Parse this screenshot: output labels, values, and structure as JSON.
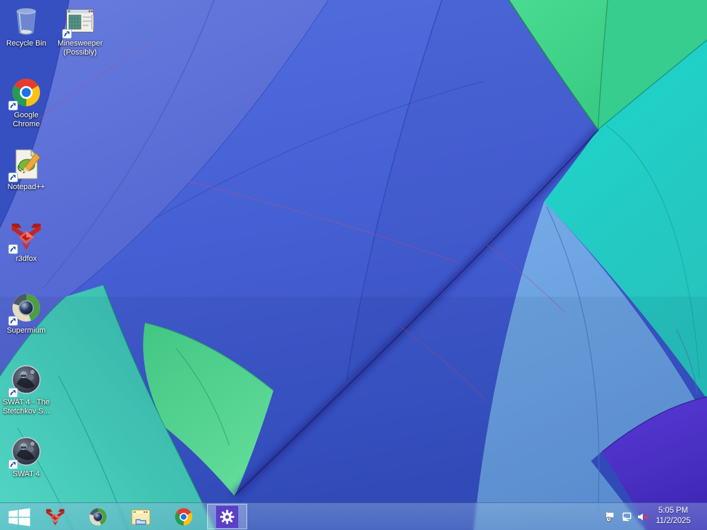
{
  "desktop": {
    "icons": [
      {
        "id": "recycle-bin",
        "label": "Recycle Bin",
        "shortcut": false
      },
      {
        "id": "minesweeper",
        "label": "Minesweeper (Possibly)",
        "shortcut": true
      },
      {
        "id": "google-chrome",
        "label": "Google Chrome",
        "shortcut": true
      },
      {
        "id": "notepad-plus-plus",
        "label": "Notepad++",
        "shortcut": true
      },
      {
        "id": "r3dfox",
        "label": "r3dfox",
        "shortcut": true
      },
      {
        "id": "supermium",
        "label": "Supermium",
        "shortcut": true
      },
      {
        "id": "swat4-stetchkov",
        "label": "SWAT 4 - The Stetchkov S...",
        "shortcut": true
      },
      {
        "id": "swat4",
        "label": "SWAT 4",
        "shortcut": true
      }
    ]
  },
  "taskbar": {
    "pinned": [
      {
        "id": "start",
        "icon": "windows-start-flag"
      },
      {
        "id": "r3dfox",
        "icon": "r3dfox-logo"
      },
      {
        "id": "supermium",
        "icon": "supermium-sphere"
      },
      {
        "id": "file-explorer",
        "icon": "folder-window"
      },
      {
        "id": "chrome",
        "icon": "chrome-circle"
      },
      {
        "id": "settings",
        "icon": "gear",
        "active": true,
        "tile_color": "#5b3fc8"
      }
    ],
    "tray": {
      "icons": [
        "action-center-flag",
        "network-monitor",
        "volume-muted"
      ],
      "time": "5:05 PM",
      "date": "11/2/2025"
    }
  },
  "wallpaper_palette": {
    "panel_blue": "#3c59d2",
    "panel_periwinkle": "#5d72da",
    "panel_teal": "#33c2b0",
    "panel_green": "#47d98b",
    "panel_cyan": "#14d2c5",
    "panel_light_blue": "#66a0e0",
    "panel_purple": "#4b2dd4"
  }
}
